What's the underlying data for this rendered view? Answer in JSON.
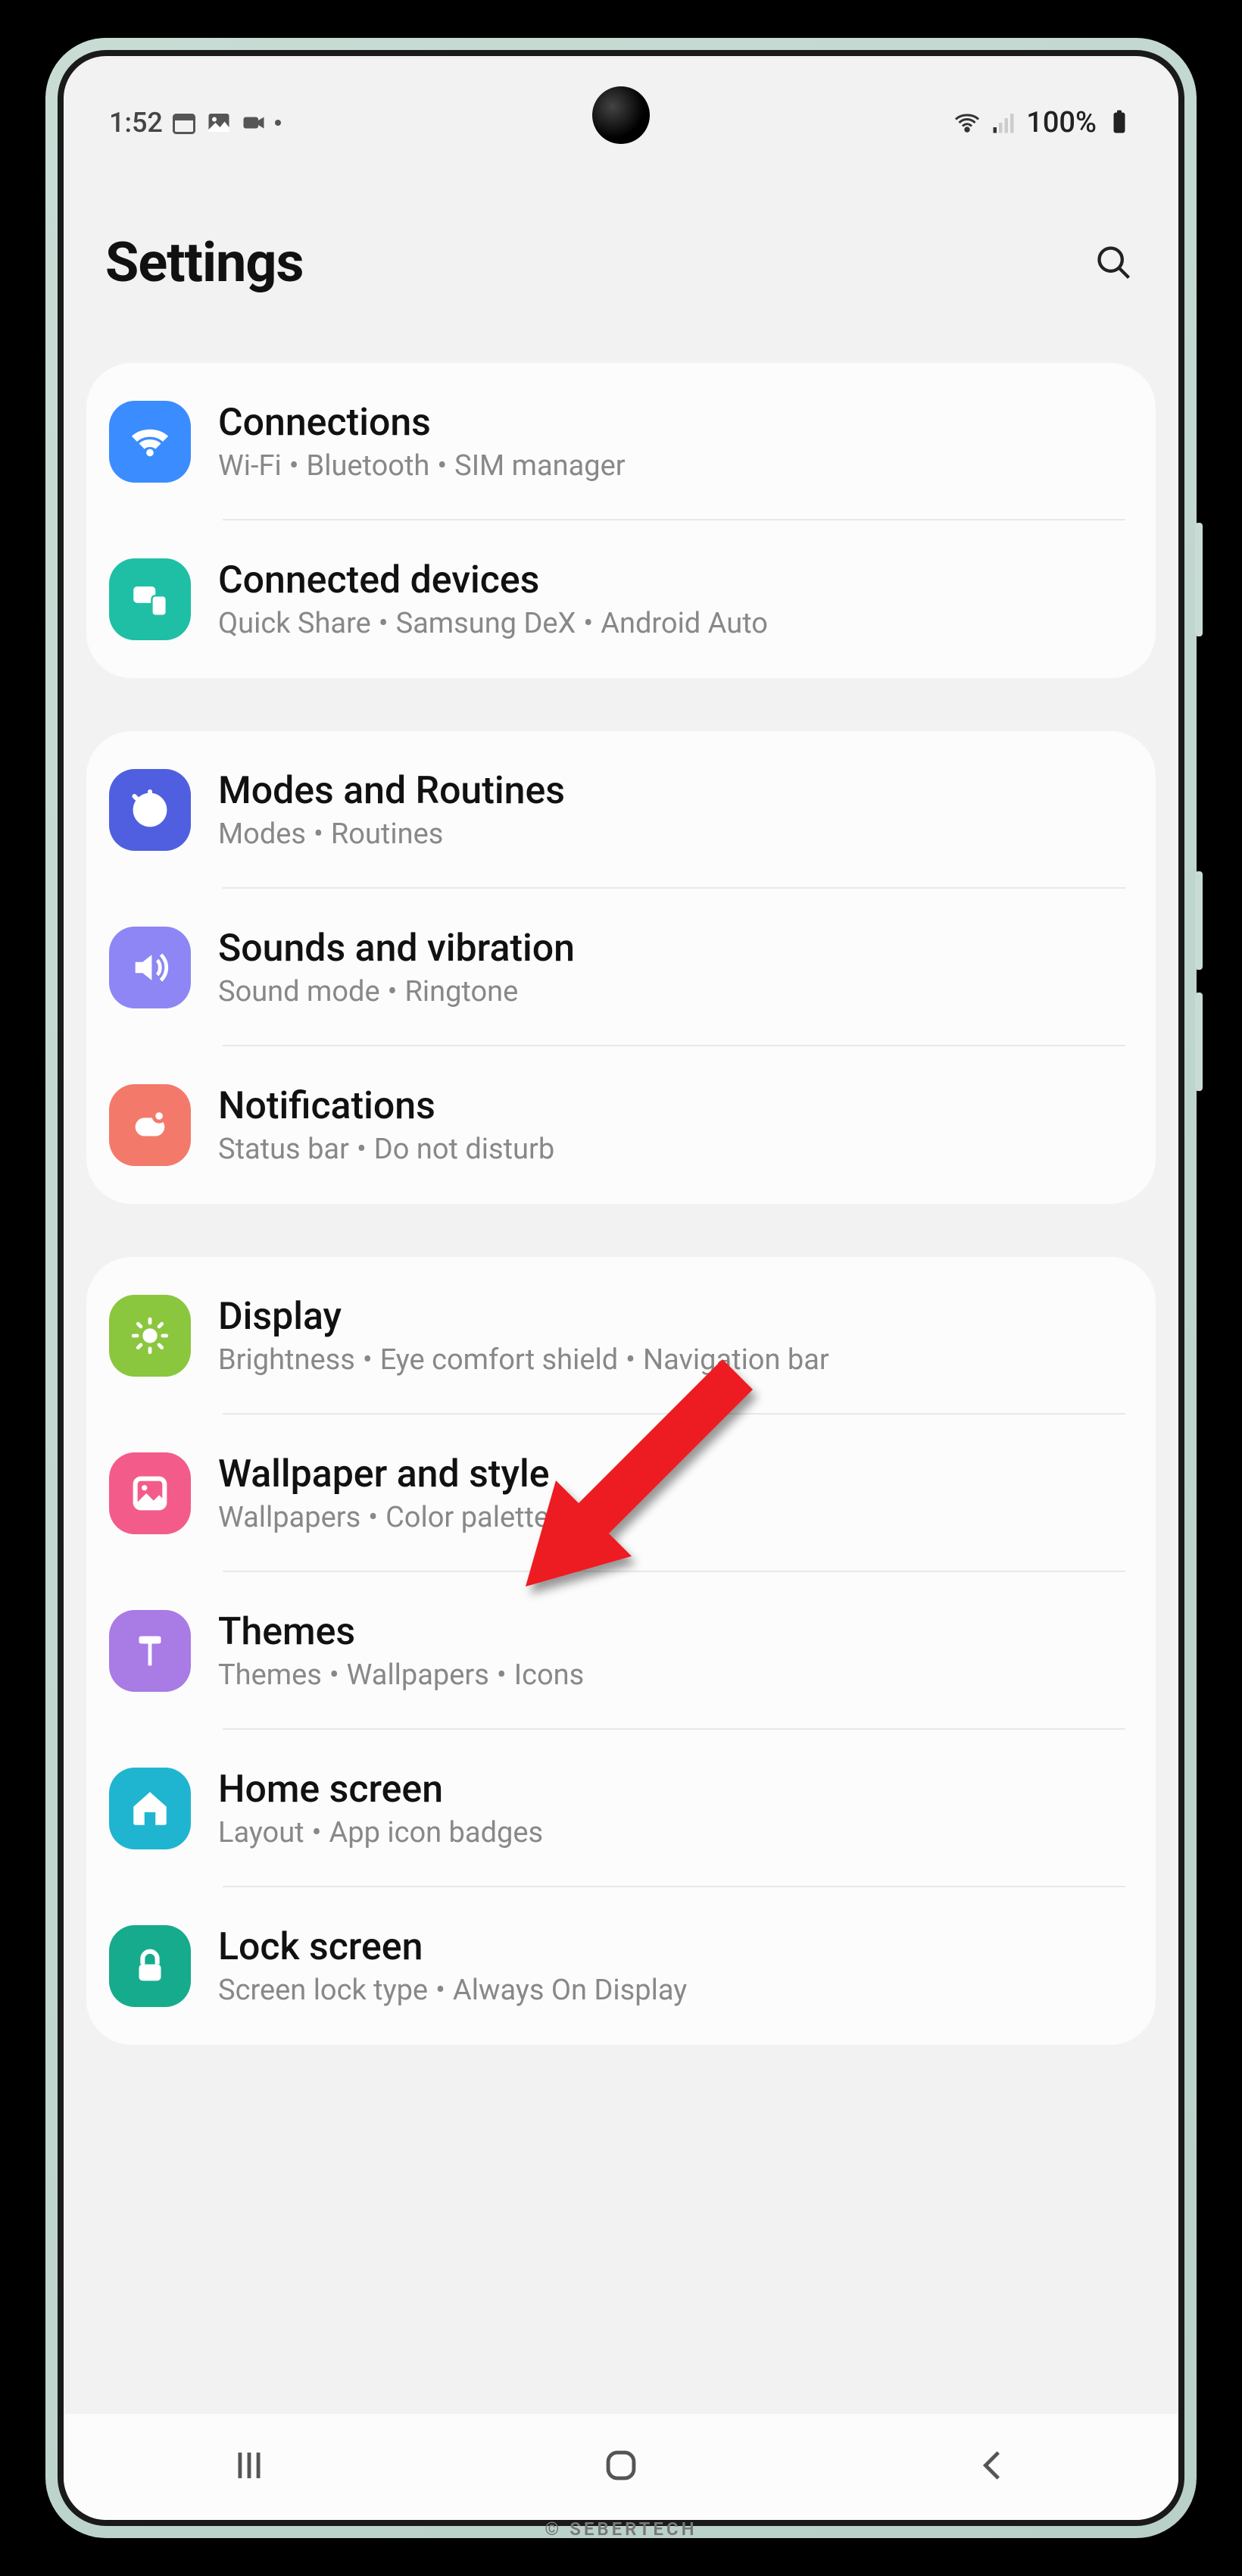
{
  "status": {
    "time": "1:52",
    "battery": "100%"
  },
  "header": {
    "title": "Settings"
  },
  "groups": [
    {
      "items": [
        {
          "icon": "wifi",
          "bg": "bg-blue",
          "title": "Connections",
          "sub": [
            "Wi-Fi",
            "Bluetooth",
            "SIM manager"
          ]
        },
        {
          "icon": "devices",
          "bg": "bg-teal",
          "title": "Connected devices",
          "sub": [
            "Quick Share",
            "Samsung DeX",
            "Android Auto"
          ]
        }
      ]
    },
    {
      "items": [
        {
          "icon": "routines",
          "bg": "bg-indigo",
          "title": "Modes and Routines",
          "sub": [
            "Modes",
            "Routines"
          ]
        },
        {
          "icon": "sound",
          "bg": "bg-purple",
          "title": "Sounds and vibration",
          "sub": [
            "Sound mode",
            "Ringtone"
          ]
        },
        {
          "icon": "notif",
          "bg": "bg-coral",
          "title": "Notifications",
          "sub": [
            "Status bar",
            "Do not disturb"
          ]
        }
      ]
    },
    {
      "items": [
        {
          "icon": "display",
          "bg": "bg-green",
          "title": "Display",
          "sub": [
            "Brightness",
            "Eye comfort shield",
            "Navigation bar"
          ]
        },
        {
          "icon": "wallpaper",
          "bg": "bg-pink",
          "title": "Wallpaper and style",
          "sub": [
            "Wallpapers",
            "Color palette"
          ]
        },
        {
          "icon": "themes",
          "bg": "bg-lilac",
          "title": "Themes",
          "sub": [
            "Themes",
            "Wallpapers",
            "Icons"
          ]
        },
        {
          "icon": "home",
          "bg": "bg-cyan",
          "title": "Home screen",
          "sub": [
            "Layout",
            "App icon badges"
          ]
        },
        {
          "icon": "lock",
          "bg": "bg-tealdark",
          "title": "Lock screen",
          "sub": [
            "Screen lock type",
            "Always On Display"
          ]
        }
      ]
    }
  ]
}
